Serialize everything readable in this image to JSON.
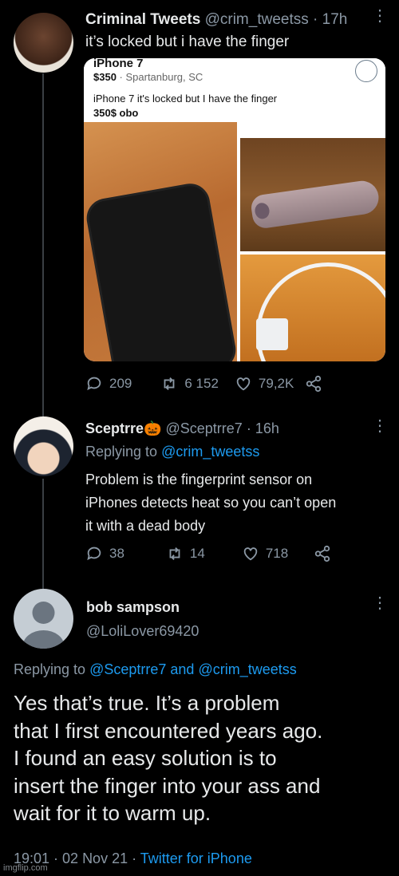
{
  "tweet1": {
    "name": "Criminal Tweets",
    "handle": "@crim_tweetss",
    "time": "· 17h",
    "text": "it’s locked but i have the finger",
    "listing": {
      "title": "iPhone 7",
      "price": "$350",
      "location": "· Spartanburg, SC",
      "desc_line1": "iPhone 7 it's locked but I have the finger",
      "desc_line2": "350$ obo"
    },
    "stats": {
      "replies": "209",
      "retweets": "6 152",
      "likes": "79,2K"
    }
  },
  "tweet2": {
    "name": "Sceptrre",
    "emoji": "🎃",
    "handle": "@Sceptrre7",
    "time": "· 16h",
    "replying_prefix": "Replying to",
    "replying_to": "@crim_tweetss",
    "text_line1": "Problem is the fingerprint sensor on",
    "text_line2": "iPhones detects heat so you can’t open",
    "text_line3": "it with a dead body",
    "stats": {
      "replies": "38",
      "retweets": "14",
      "likes": "718"
    }
  },
  "tweet3": {
    "name": "bob sampson",
    "handle": "@LoliLover69420",
    "replying_prefix": "Replying to",
    "replying_to_1": "@Sceptrre7",
    "and": "and",
    "replying_to_2": "@crim_tweetss",
    "text_line1": "Yes that’s true. It’s a problem",
    "text_line2": "that I first encountered years ago.",
    "text_line3": "I found an easy solution is to",
    "text_line4": "insert the finger into your ass and",
    "text_line5": "wait for it to warm up.",
    "timestamp": "19:01 · 02 Nov 21 ·",
    "source": "Twitter for iPhone"
  },
  "watermark": "imgflip.com",
  "colors": {
    "background": "#000000",
    "text": "#e7e9ea",
    "muted": "#8b98a5",
    "link": "#1d9bf0"
  }
}
